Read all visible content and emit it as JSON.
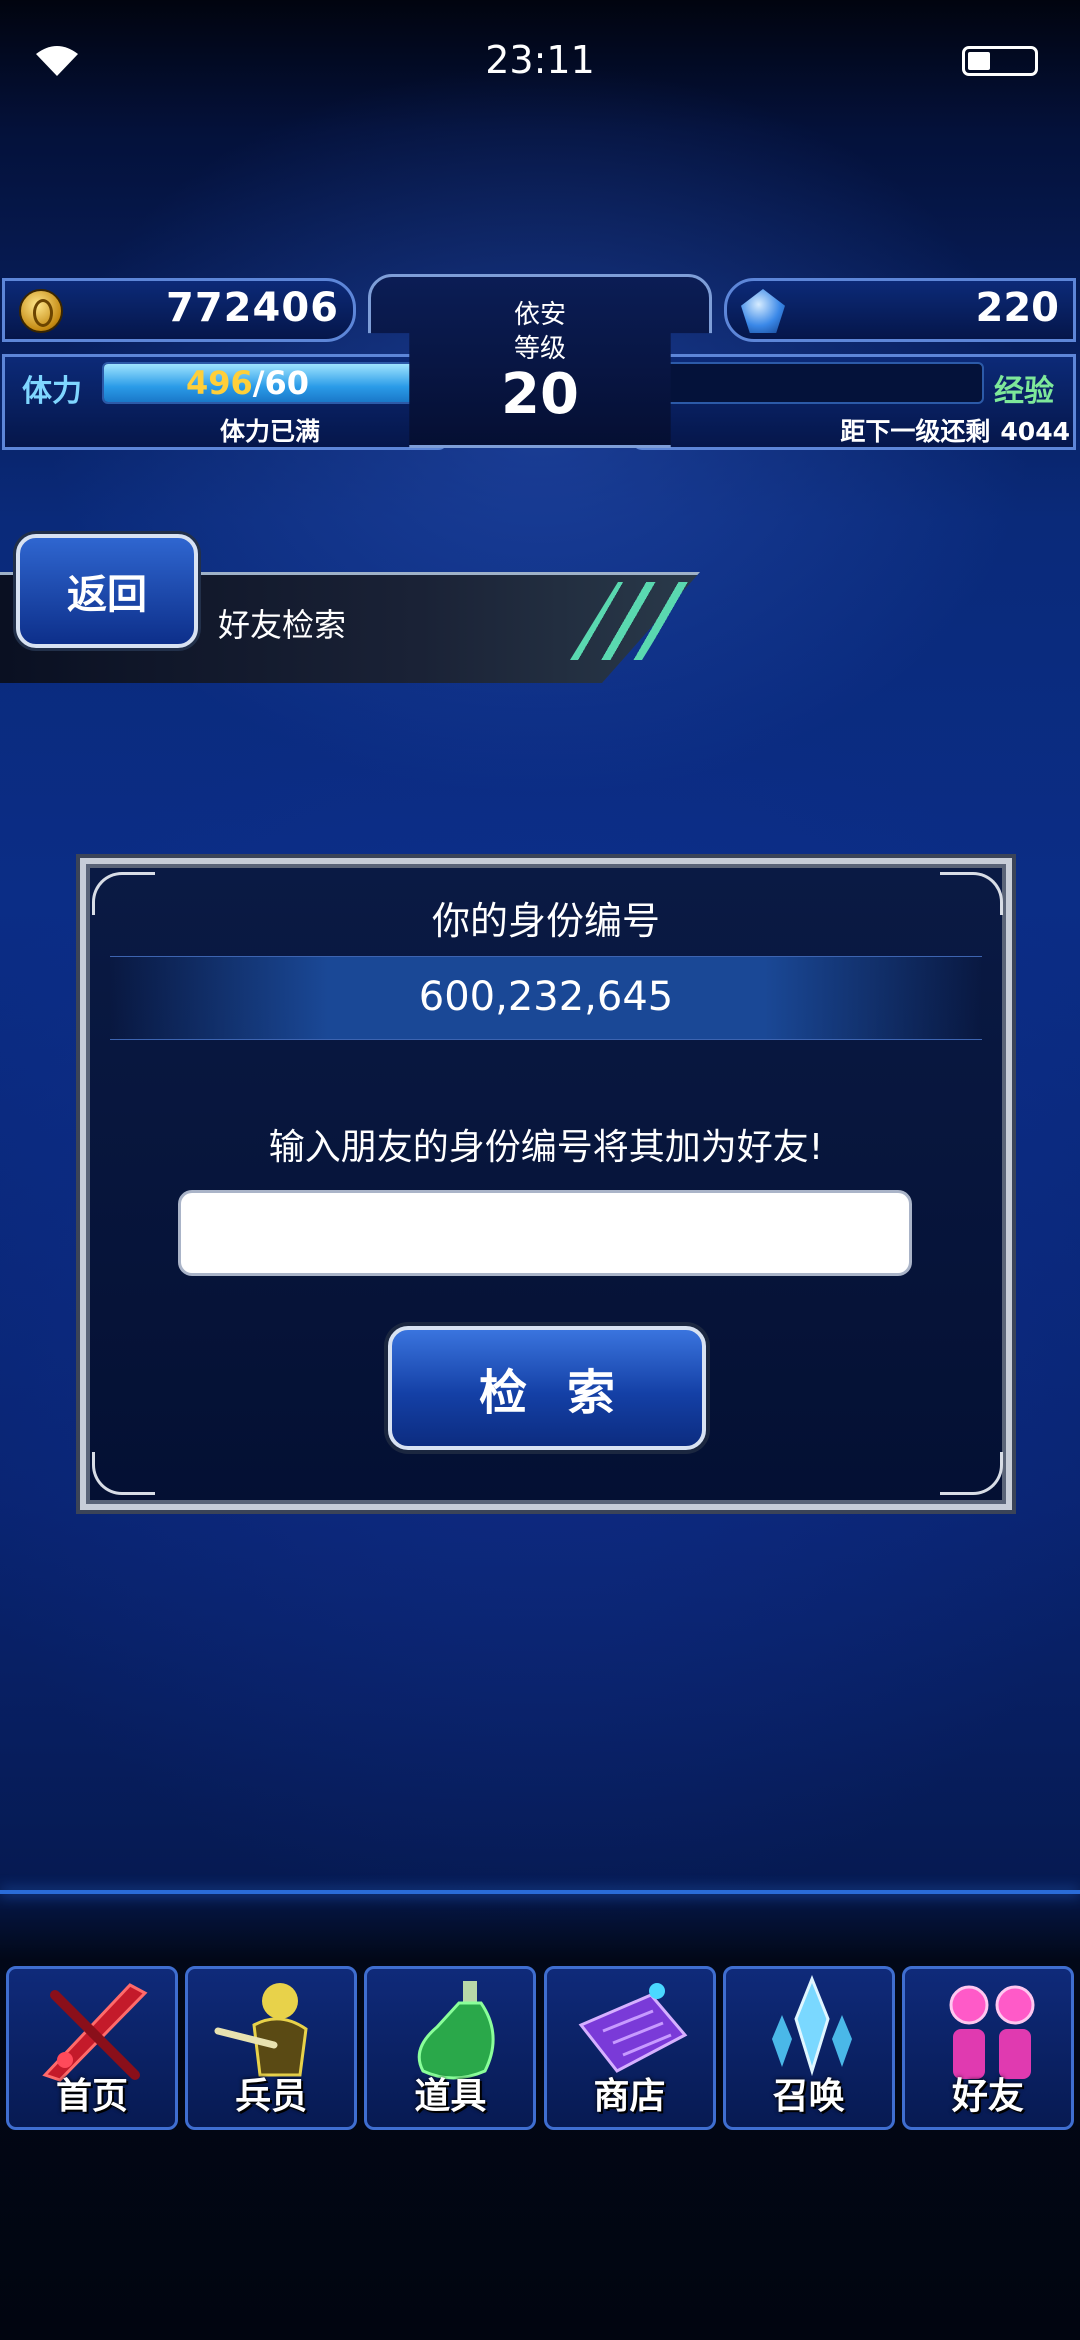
{
  "status_bar": {
    "time": "23:11",
    "battery_level": 0.35
  },
  "hud": {
    "gil": "772406",
    "gems": "220",
    "player_name": "依安",
    "level_label": "等级",
    "level": "20",
    "stamina_label": "体力",
    "stamina_current": "496",
    "stamina_max": "/60",
    "stamina_fill": 1.0,
    "stamina_status": "体力已满",
    "exp_label": "经验",
    "exp_fill": 0.01,
    "exp_status_label": "距下一级还剩",
    "exp_remaining": "4044"
  },
  "breadcrumb": {
    "back_label": "返回",
    "page_title": "好友检索"
  },
  "dialog": {
    "title": "你的身份编号",
    "player_id": "600,232,645",
    "instruction": "输入朋友的身份编号将其加为好友!",
    "input_value": "",
    "search_label": "检索"
  },
  "nav": {
    "items": [
      {
        "label": "首页",
        "icon": "sword-icon"
      },
      {
        "label": "兵员",
        "icon": "warrior-icon"
      },
      {
        "label": "道具",
        "icon": "potion-icon"
      },
      {
        "label": "商店",
        "icon": "shop-icon"
      },
      {
        "label": "召唤",
        "icon": "crystal-icon"
      },
      {
        "label": "好友",
        "icon": "friends-icon"
      }
    ]
  },
  "colors": {
    "stamina_current": "#ffcf3a",
    "stamina_label": "#7fd6ff",
    "exp_label": "#7ee89a",
    "nav_border": "#3f6ed0"
  }
}
